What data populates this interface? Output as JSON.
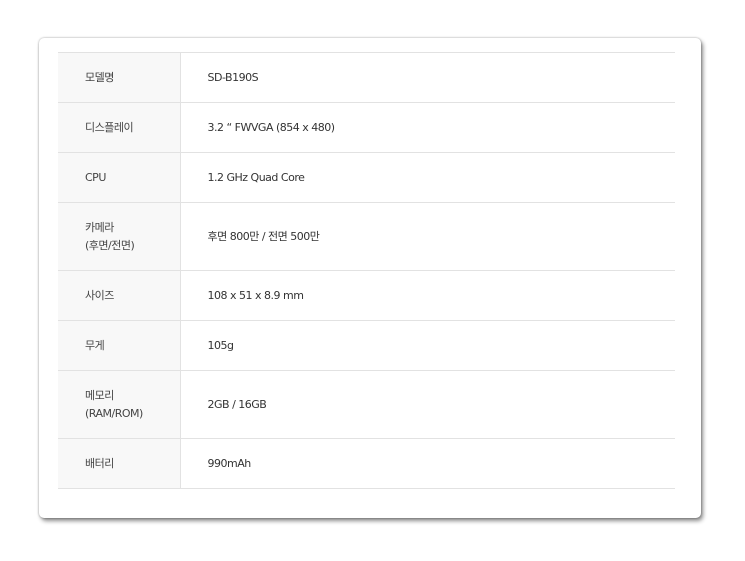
{
  "specs": [
    {
      "label": "모델명",
      "value": "SD-B190S"
    },
    {
      "label": "디스플레이",
      "value": "3.2 “ FWVGA (854 x 480)"
    },
    {
      "label": "CPU",
      "value": "1.2 GHz Quad Core"
    },
    {
      "label": "카메라\n(후면/전면)",
      "value": "후면 800만 / 전면 500만"
    },
    {
      "label": "사이즈",
      "value": "108 x 51 x 8.9 mm"
    },
    {
      "label": "무게",
      "value": "105g"
    },
    {
      "label": "메모리\n(RAM/ROM)",
      "value": "2GB / 16GB"
    },
    {
      "label": "배터리",
      "value": "990mAh"
    }
  ]
}
